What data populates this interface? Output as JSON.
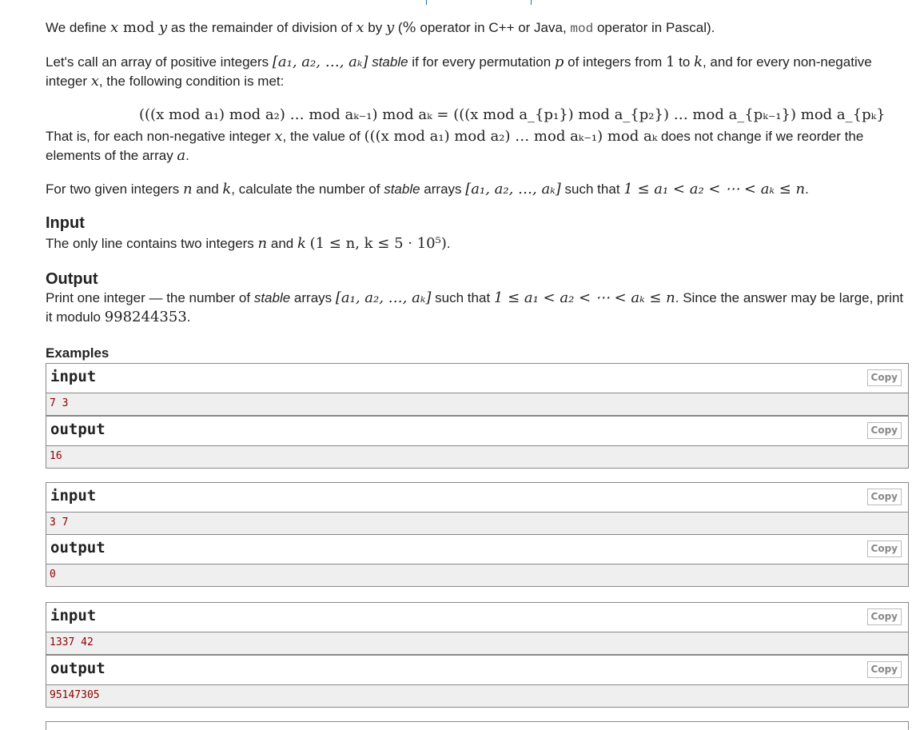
{
  "statement": {
    "p1": {
      "t1": "We define ",
      "m1": "x",
      "m2": " mod ",
      "m3": "y",
      "t2": " as the remainder of division of ",
      "m4": "x",
      "t3": " by ",
      "m5": "y",
      "t4": " (",
      "m6": "%",
      "t5": " operator in C++ or Java, ",
      "code": "mod",
      "t6": " operator in Pascal)."
    },
    "p2": {
      "t1": "Let's call an array of positive integers ",
      "m1": "[a₁, a₂, …, aₖ]",
      "t2": " ",
      "em": "stable",
      "t3": " if for every permutation ",
      "m2": "p",
      "t4": " of integers from ",
      "m3": "1",
      "t5": " to ",
      "m4": "k",
      "t6": ", and for every non-negative integer ",
      "m5": "x",
      "t7": ", the following condition is met:"
    },
    "formula": "(((x mod a₁) mod a₂) … mod aₖ₋₁) mod aₖ = (((x mod a_{p₁}) mod a_{p₂}) … mod a_{pₖ₋₁}) mod a_{pₖ}",
    "p3": {
      "t1": "That is, for each non-negative integer ",
      "m1": "x",
      "t2": ", the value of ",
      "m2": "(((x mod a₁) mod a₂) … mod aₖ₋₁) mod aₖ",
      "t3": " does not change if we reorder the elements of the array ",
      "m3": "a",
      "t4": "."
    },
    "p4": {
      "t1": "For two given integers ",
      "m1": "n",
      "t2": " and ",
      "m2": "k",
      "t3": ", calculate the number of ",
      "em": "stable",
      "t4": " arrays ",
      "m3": "[a₁, a₂, …, aₖ]",
      "t5": " such that ",
      "m4": "1 ≤ a₁ < a₂ < ⋯ < aₖ ≤ n",
      "t6": "."
    }
  },
  "input_section": {
    "title": "Input",
    "t1": "The only line contains two integers ",
    "m1": "n",
    "t2": " and ",
    "m2": "k",
    "t3": " ",
    "m3": "(1 ≤ n, k ≤ 5 · 10⁵)",
    "t4": "."
  },
  "output_section": {
    "title": "Output",
    "t1": "Print one integer — the number of ",
    "em": "stable",
    "t2": " arrays ",
    "m1": "[a₁, a₂, …, aₖ]",
    "t3": " such that ",
    "m2": "1 ≤ a₁ < a₂ < ⋯ < aₖ ≤ n",
    "t4": ". Since the answer may be large, print it modulo ",
    "m3": "998244353",
    "t5": "."
  },
  "examples": {
    "title": "Examples",
    "input_label": "input",
    "output_label": "output",
    "copy_label": "Copy",
    "items": [
      {
        "input": "7 3",
        "output": "16"
      },
      {
        "input": "3 7",
        "output": "0"
      },
      {
        "input": "1337 42",
        "output": "95147305"
      }
    ]
  }
}
